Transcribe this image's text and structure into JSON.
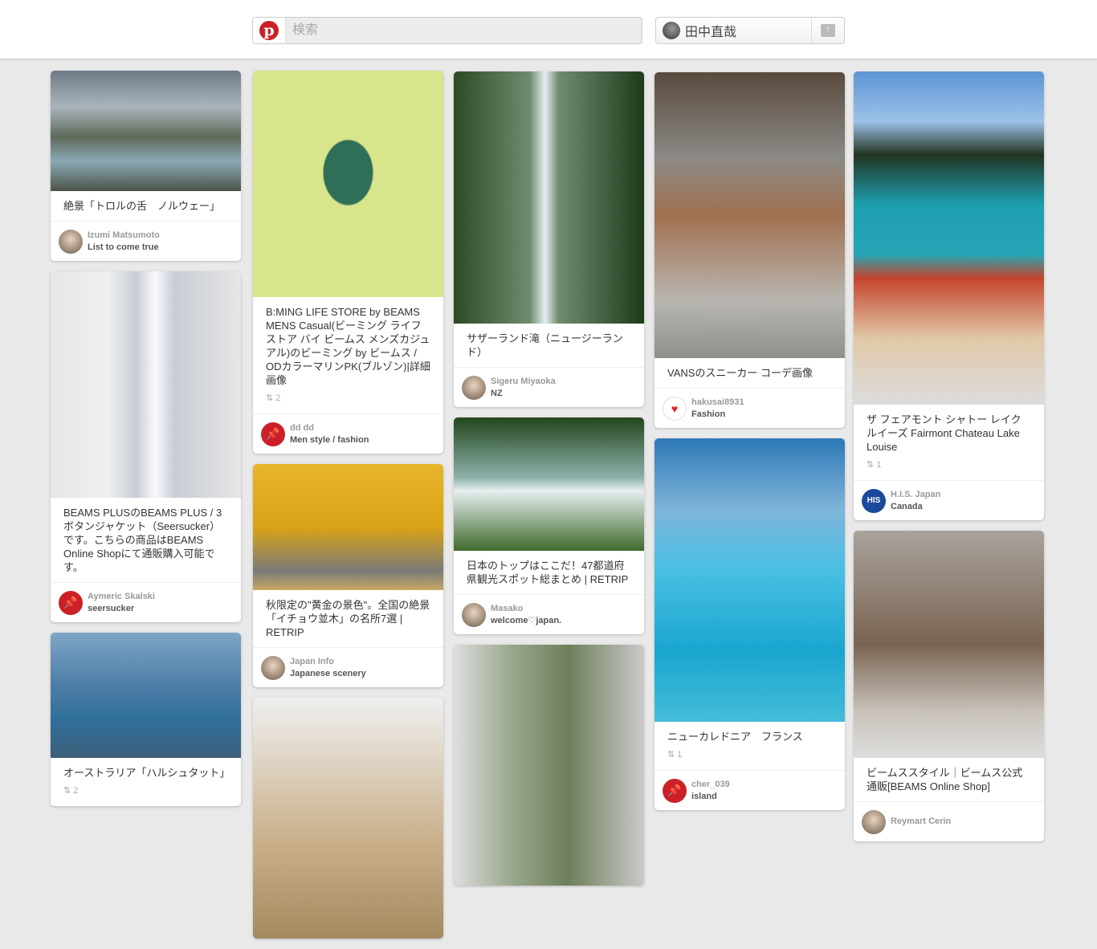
{
  "header": {
    "search_placeholder": "検索",
    "user_name": "田中直哉",
    "logo": "p"
  },
  "columns": [
    [
      {
        "title": "絶景「トロルの舌　ノルウェー」",
        "user": "Izumi Matsumoto",
        "board": "List to come true",
        "avatar": "photo"
      },
      {
        "title": "BEAMS PLUSのBEAMS PLUS / 3ボタンジャケット（Seersucker）です。こちらの商品はBEAMS Online Shopにて通販購入可能です。",
        "user": "Aymeric Skalski",
        "board": "seersucker",
        "avatar": "pin"
      },
      {
        "title": "オーストラリア「ハルシュタット」",
        "repins": "2"
      }
    ],
    [
      {
        "title": "B:MING LIFE STORE by BEAMS MENS Casual(ビーミング ライフストア バイ ビームス メンズカジュアル)のビーミング by ビームス / ODカラーマリンPK(ブルゾン)|詳細画像",
        "repins": "2",
        "user": "dd dd",
        "board": "Men style / fashion",
        "avatar": "pin"
      },
      {
        "title": "秋限定の\"黄金の景色\"。全国の絶景「イチョウ並木」の名所7選 | RETRIP",
        "user": "Japan Info",
        "board": "Japanese scenery",
        "avatar": "photo"
      },
      {}
    ],
    [
      {
        "title": "サザーランド滝（ニュージーランド）",
        "user": "Sigeru Miyaoka",
        "board": "NZ",
        "avatar": "photo"
      },
      {
        "title": "日本のトップはここだ！47都道府県観光スポット総まとめ | RETRIP",
        "user": "Masako",
        "board": "welcome♡japan.",
        "avatar": "photo"
      },
      {}
    ],
    [
      {
        "title": "VANSのスニーカー コーデ画像",
        "user": "hakusai8931",
        "board": "Fashion",
        "avatar": "heart"
      },
      {
        "title": "ニューカレドニア　フランス",
        "repins": "1",
        "user": "cher_039",
        "board": "island",
        "avatar": "pin"
      }
    ],
    [
      {
        "title": "ザ フェアモント シャトー レイクルイーズ Fairmont Chateau Lake Louise",
        "repins": "1",
        "user": "H.I.S. Japan",
        "board": "Canada",
        "avatar": "his"
      },
      {
        "title": "ビームススタイル｜ビームス公式通販[BEAMS Online Shop]",
        "user": "Reymart Cerin",
        "avatar": "photo"
      }
    ]
  ],
  "colors": {
    "brand": "#cb2027",
    "bg": "#e9e9e9"
  }
}
